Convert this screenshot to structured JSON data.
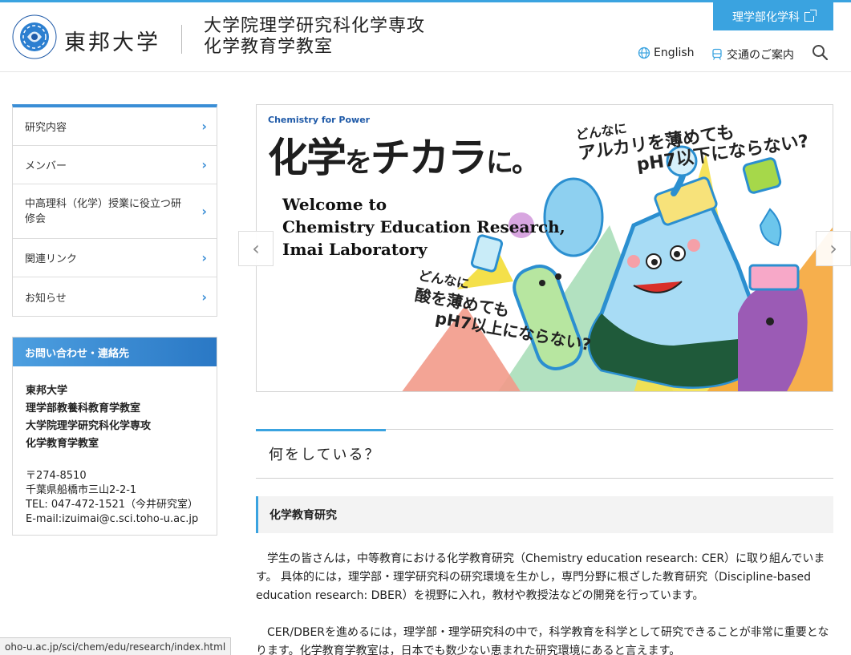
{
  "header": {
    "university_name": "東邦大学",
    "department_line1": "大学院理学研究科化学専攻",
    "department_line2": "化学教育学教室",
    "rigaku_button": "理学部化学科",
    "english_link": "English",
    "access_link": "交通のご案内",
    "logo_ring_text": "TOHO UNIVERSITY NATURE LIFE MAN"
  },
  "sidebar": {
    "items": [
      {
        "label": "研究内容"
      },
      {
        "label": "メンバー"
      },
      {
        "label": "中高理科（化学）授業に役立つ研修会"
      },
      {
        "label": "関連リンク"
      },
      {
        "label": "お知らせ"
      }
    ]
  },
  "contact": {
    "heading": "お問い合わせ・連絡先",
    "org": [
      "東邦大学",
      "理学部教養科教育学教室",
      "大学院理学研究科化学専攻",
      "化学教育学教室"
    ],
    "address": [
      "〒274-8510",
      "千葉県船橋市三山2-2-1",
      "TEL: 047-472-1521（今井研究室）",
      "E-mail:izuimai@c.sci.toho-u.ac.jp"
    ]
  },
  "slider": {
    "tag": "Chemistry for Power",
    "headline_a": "化学",
    "headline_b": "を",
    "headline_c": "チカラ",
    "headline_d": "に。",
    "welcome_lines": [
      "Welcome to",
      "Chemistry Education Research,",
      "Imai Laboratory"
    ],
    "bubble_top_1": "どんなに",
    "bubble_top_2": "アルカリを薄めても",
    "bubble_top_3": "pH7以下にならない?",
    "bubble_bottom_1": "どんなに",
    "bubble_bottom_2": "酸を薄めても",
    "bubble_bottom_3": "pH7以上にならない?"
  },
  "main": {
    "section_title": "何をしている？",
    "subheading": "化学教育研究",
    "paragraph1": "学生の皆さんは，中等教育における化学教育研究（Chemistry education research: CER）に取り組んでいます。 具体的には，理学部・理学研究科の研究環境を生かし，専門分野に根ざした教育研究（Discipline-based education research: DBER）を視野に入れ，教材や教授法などの開発を行っています。",
    "paragraph2": "CER/DBERを進めるには，理学部・理学研究科の中で，科学教育を科学として研究できることが非常に重要となります。化学教育学教室は，日本でも数少ない恵まれた研究環境にあると言えます。"
  },
  "status_bar": {
    "url": "oho-u.ac.jp/sci/chem/edu/research/index.html"
  },
  "colors": {
    "accent": "#3aa3e0",
    "nav_accent": "#3a8ed6"
  }
}
